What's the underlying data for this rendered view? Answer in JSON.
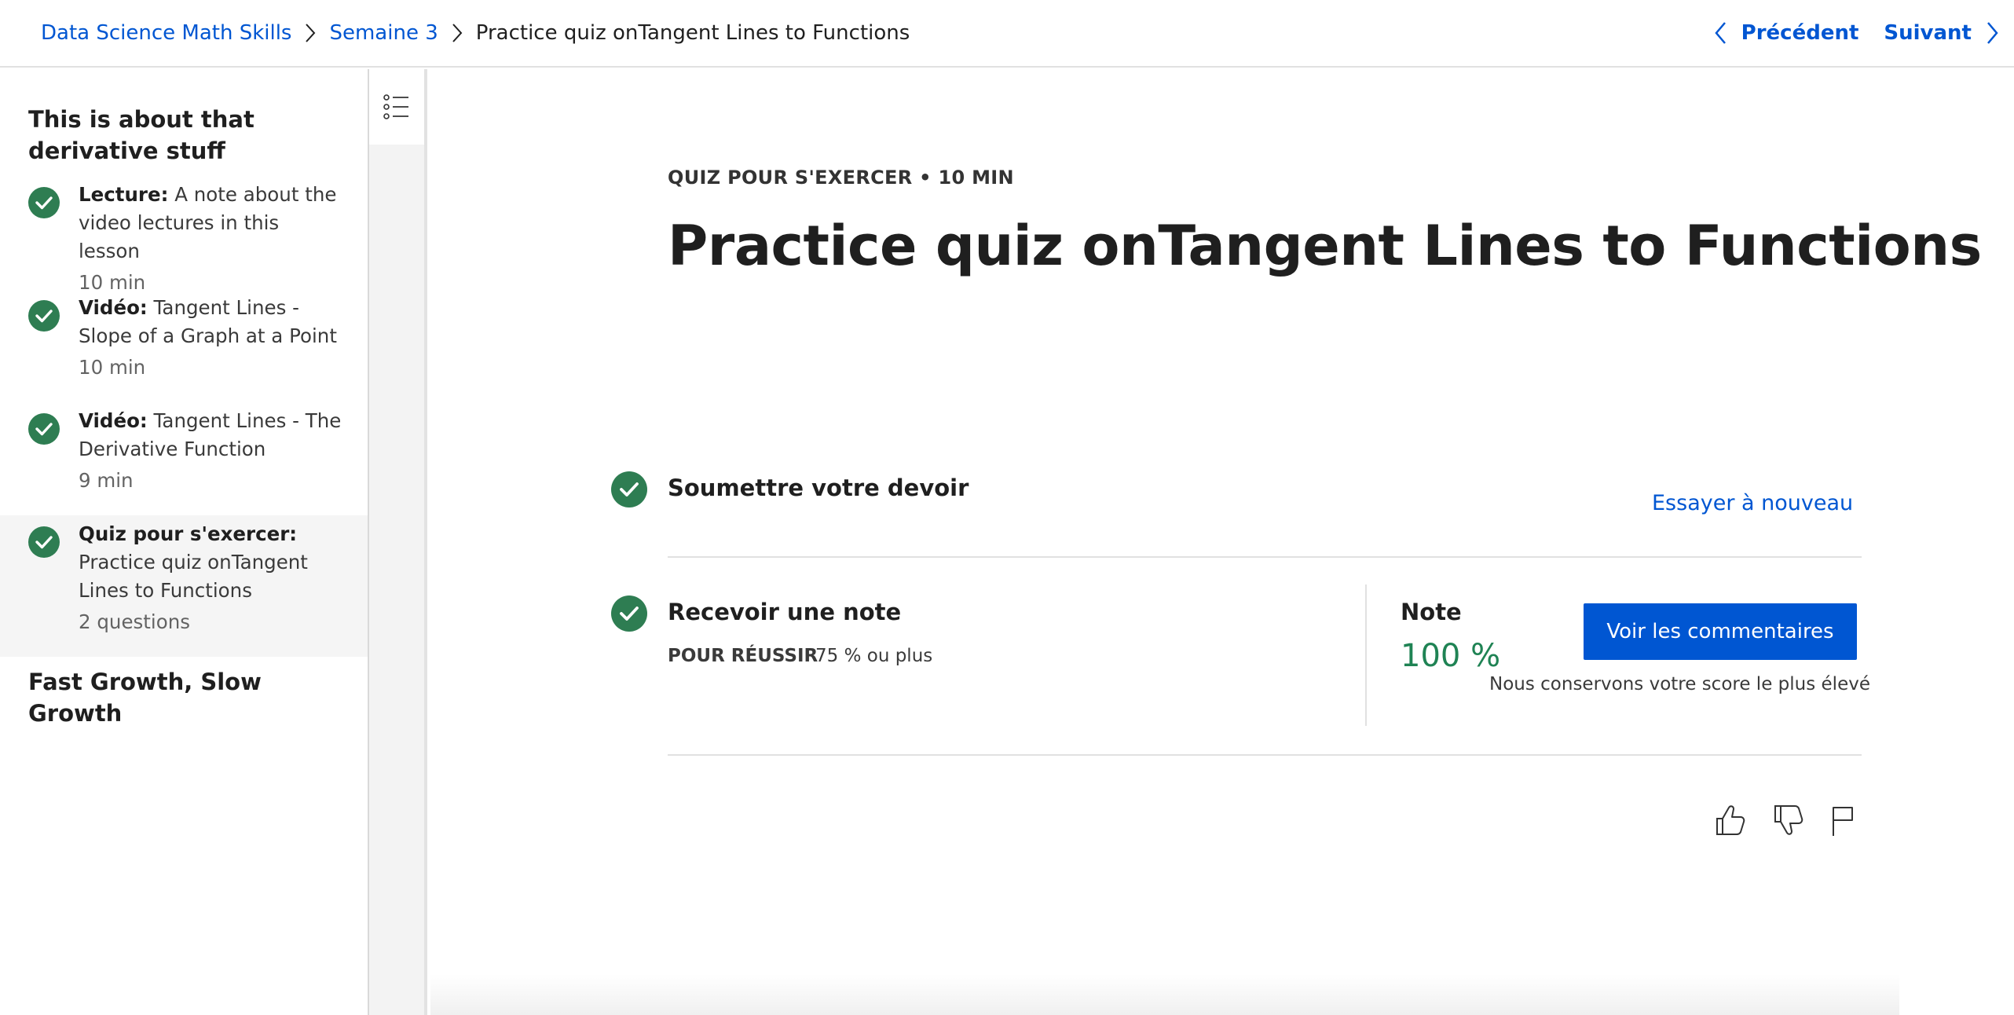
{
  "breadcrumb": {
    "items": [
      "Data Science Math Skills",
      "Semaine 3"
    ],
    "current": "Practice quiz onTangent Lines to Functions"
  },
  "nav": {
    "previous": "Précédent",
    "next": "Suivant"
  },
  "sidebar": {
    "section_title": "This is about that derivative stuff",
    "lessons": [
      {
        "type": "Lecture:",
        "title": "A note about the video lectures in this lesson",
        "duration": "10 min",
        "completed": true
      },
      {
        "type": "Vidéo:",
        "title": "Tangent Lines - Slope of a Graph at a Point",
        "duration": "10 min",
        "completed": true
      },
      {
        "type": "Vidéo:",
        "title": "Tangent Lines - The Derivative Function",
        "duration": "9 min",
        "completed": true
      },
      {
        "type": "Quiz pour s'exercer:",
        "title": "Practice quiz onTangent Lines to Functions",
        "duration": "2 questions",
        "completed": true,
        "active": true
      }
    ],
    "next_section_title": "Fast Growth, Slow Growth"
  },
  "main": {
    "eyebrow": "QUIZ POUR S'EXERCER • 10 MIN",
    "title": "Practice quiz onTangent Lines to Functions",
    "submit": {
      "label": "Soumettre votre devoir",
      "retry": "Essayer à nouveau"
    },
    "grade": {
      "label": "Recevoir une note",
      "pass_label": "POUR RÉUSSIR",
      "pass_value": "75 % ou plus",
      "note_label": "Note",
      "note_value": "100 %",
      "feedback_button": "Voir les commentaires",
      "keep_note": "Nous conservons votre score le plus élevé"
    }
  },
  "colors": {
    "accent": "#0056d2",
    "success": "#1f8354",
    "check": "#2e7d52"
  },
  "icons": [
    "chevron-right-icon",
    "chevron-left-icon",
    "list-icon",
    "check-circle-icon",
    "thumbs-up-icon",
    "thumbs-down-icon",
    "flag-icon"
  ]
}
